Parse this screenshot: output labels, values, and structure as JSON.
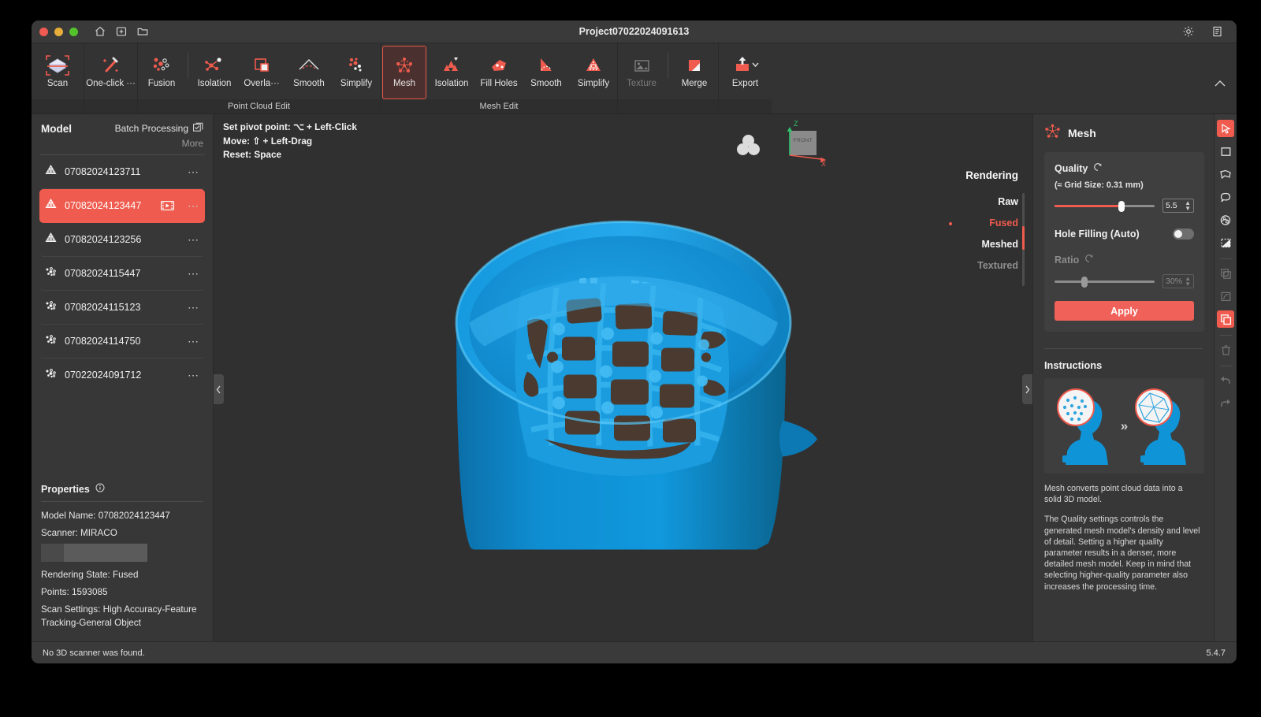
{
  "window": {
    "title": "Project07022024091613",
    "traffic": [
      "close-button",
      "minimize-button",
      "maximize-button"
    ],
    "left_icons": [
      "home-icon",
      "new-project-icon",
      "open-folder-icon"
    ],
    "right_icons": [
      "gear-icon",
      "notes-icon"
    ]
  },
  "ribbon": {
    "groups": [
      {
        "caption": "",
        "buttons": [
          {
            "label": "Scan",
            "icon": "scan-cube-icon",
            "state": "normal"
          }
        ]
      },
      {
        "caption": "",
        "buttons": [
          {
            "label": "One-click ···",
            "icon": "magic-wand-icon",
            "state": "normal"
          }
        ]
      },
      {
        "caption": "Point Cloud Edit",
        "buttons": [
          {
            "label": "Fusion",
            "icon": "point-fusion-icon",
            "state": "normal"
          },
          {
            "label": "Isolation",
            "icon": "point-isolation-icon",
            "state": "normal"
          },
          {
            "label": "Overla···",
            "icon": "overlap-squares-icon",
            "state": "normal"
          },
          {
            "label": "Smooth",
            "icon": "smooth-arc-icon",
            "state": "normal"
          },
          {
            "label": "Simplify",
            "icon": "simplify-points-icon",
            "state": "normal"
          }
        ]
      },
      {
        "caption": "Mesh Edit",
        "buttons": [
          {
            "label": "Mesh",
            "icon": "mesh-nodes-icon",
            "state": "active"
          },
          {
            "label": "Isolation",
            "icon": "mesh-isolation-icon",
            "state": "normal"
          },
          {
            "label": "Fill Holes",
            "icon": "fill-holes-icon",
            "state": "normal"
          },
          {
            "label": "Smooth",
            "icon": "mesh-smooth-icon",
            "state": "normal"
          },
          {
            "label": "Simplify",
            "icon": "mesh-simplify-icon",
            "state": "normal"
          }
        ]
      },
      {
        "caption": "",
        "buttons": [
          {
            "label": "Texture",
            "icon": "texture-image-icon",
            "state": "disabled"
          },
          {
            "label": "Merge",
            "icon": "merge-squares-icon",
            "state": "normal"
          }
        ]
      },
      {
        "caption": "",
        "buttons": [
          {
            "label": "Export",
            "icon": "export-upload-icon",
            "state": "normal"
          }
        ]
      }
    ],
    "collapse_icon": "chevron-up-icon"
  },
  "left_panel": {
    "title": "Model",
    "batch_label": "Batch Processing",
    "batch_icon": "batch-checkbox-icon",
    "more_label": "More",
    "items": [
      {
        "name": "07082024123711",
        "icon": "mesh-model-icon",
        "selected": false,
        "has_video": false
      },
      {
        "name": "07082024123447",
        "icon": "mesh-model-icon",
        "selected": true,
        "has_video": true
      },
      {
        "name": "07082024123256",
        "icon": "mesh-model-icon",
        "selected": false,
        "has_video": false
      },
      {
        "name": "07082024115447",
        "icon": "pointcloud-model-icon",
        "selected": false,
        "has_video": false
      },
      {
        "name": "07082024115123",
        "icon": "pointcloud-model-icon",
        "selected": false,
        "has_video": false
      },
      {
        "name": "07082024114750",
        "icon": "pointcloud-model-icon",
        "selected": false,
        "has_video": false
      },
      {
        "name": "07022024091712",
        "icon": "pointcloud-model-icon",
        "selected": false,
        "has_video": false
      }
    ],
    "properties": {
      "heading": "Properties",
      "info_icon": "info-circle-icon",
      "model_name_key": "Model Name:",
      "model_name_value": "07082024123447",
      "scanner_key": "Scanner:",
      "scanner_value": "MIRACO",
      "rendering_state_key": "Rendering State:",
      "rendering_state_value": "Fused",
      "points_key": "Points:",
      "points_value": "1593085",
      "scan_settings_key": "Scan Settings:",
      "scan_settings_value": "High Accuracy-Feature Tracking-General Object"
    }
  },
  "viewport": {
    "hints": [
      "Set pivot point: ⌥ + Left-Click",
      "Move: ⇧ + Left-Drag",
      "Reset: Space"
    ],
    "axis": {
      "z_label": "Z",
      "x_label": "X",
      "face_label": "FRONT"
    },
    "rendering": {
      "title": "Rendering",
      "options": [
        "Raw",
        "Fused",
        "Meshed",
        "Textured"
      ],
      "current": "Fused",
      "disabled": [
        "Textured"
      ]
    },
    "collapse_left_icon": "chevron-left-icon",
    "collapse_right_icon": "chevron-right-icon",
    "model_color": "#0e8fd4"
  },
  "right_panel": {
    "header": "Mesh",
    "header_icon": "mesh-nodes-icon",
    "quality": {
      "label": "Quality",
      "refresh_icon": "reset-icon",
      "grid_size_note": "(≈ Grid Size: 0.31 mm)",
      "value": "5.5",
      "fill_percent": 67
    },
    "hole_filling": {
      "label": "Hole Filling (Auto)",
      "enabled": false
    },
    "ratio": {
      "label": "Ratio",
      "refresh_icon": "reset-icon",
      "value": "30%",
      "fill_percent": 30,
      "disabled": true
    },
    "apply_label": "Apply",
    "instructions": {
      "heading": "Instructions",
      "diagram": {
        "left_icon": "pointcloud-bust-thumbnail",
        "arrow_icon": "double-chevron-right-icon",
        "right_icon": "mesh-bust-thumbnail"
      },
      "paragraphs": [
        "Mesh converts point cloud data into a solid 3D model.",
        "The Quality settings controls the generated mesh model's density and level of detail. Setting a higher quality parameter results in a denser, more detailed mesh model. Keep in mind that selecting higher-quality parameter also increases the processing time."
      ]
    }
  },
  "right_rail": {
    "icons": [
      {
        "name": "select-cursor-icon",
        "state": "active"
      },
      {
        "name": "rectangle-select-icon",
        "state": "normal"
      },
      {
        "name": "lasso-select-icon",
        "state": "normal"
      },
      {
        "name": "freehand-select-icon",
        "state": "normal"
      },
      {
        "name": "brush-select-icon",
        "state": "normal"
      },
      {
        "name": "invert-select-icon",
        "state": "normal"
      },
      {
        "name": "duplicate-icon",
        "state": "disabled"
      },
      {
        "name": "through-select-icon",
        "state": "disabled"
      },
      {
        "name": "copy-icon",
        "state": "active"
      },
      {
        "name": "delete-icon",
        "state": "disabled"
      },
      {
        "name": "undo-icon",
        "state": "disabled"
      },
      {
        "name": "redo-icon",
        "state": "disabled"
      }
    ]
  },
  "status_bar": {
    "message": "No 3D scanner was found.",
    "version": "5.4.7"
  },
  "colors": {
    "accent": "#ef5b4e",
    "panel": "#373737",
    "viewport": "#303030",
    "model": "#0e8fd4"
  }
}
